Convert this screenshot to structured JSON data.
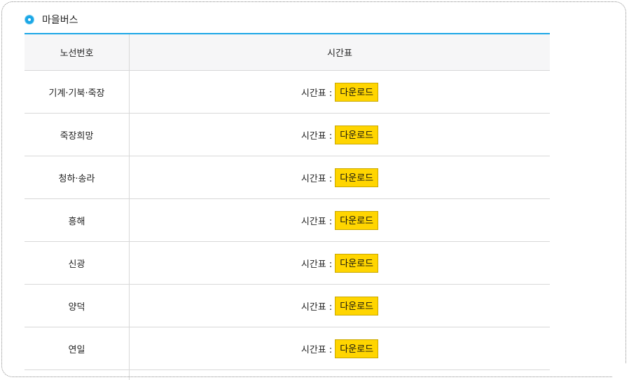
{
  "section": {
    "title": "마을버스",
    "icon": "bullet-circle-icon"
  },
  "table": {
    "headers": {
      "route": "노선번호",
      "schedule": "시간표"
    },
    "rows": [
      {
        "route": "기계·기북·죽장",
        "label": "시간표 :",
        "button": "다운로드"
      },
      {
        "route": "죽장희망",
        "label": "시간표 :",
        "button": "다운로드"
      },
      {
        "route": "청하·송라",
        "label": "시간표 :",
        "button": "다운로드"
      },
      {
        "route": "흥해",
        "label": "시간표 :",
        "button": "다운로드"
      },
      {
        "route": "신광",
        "label": "시간표 :",
        "button": "다운로드"
      },
      {
        "route": "양덕",
        "label": "시간표 :",
        "button": "다운로드"
      },
      {
        "route": "연일",
        "label": "시간표 :",
        "button": "다운로드"
      }
    ]
  },
  "colors": {
    "accent": "#1ba7e6",
    "button": "#ffd500",
    "header_bg": "#f6f6f7"
  }
}
